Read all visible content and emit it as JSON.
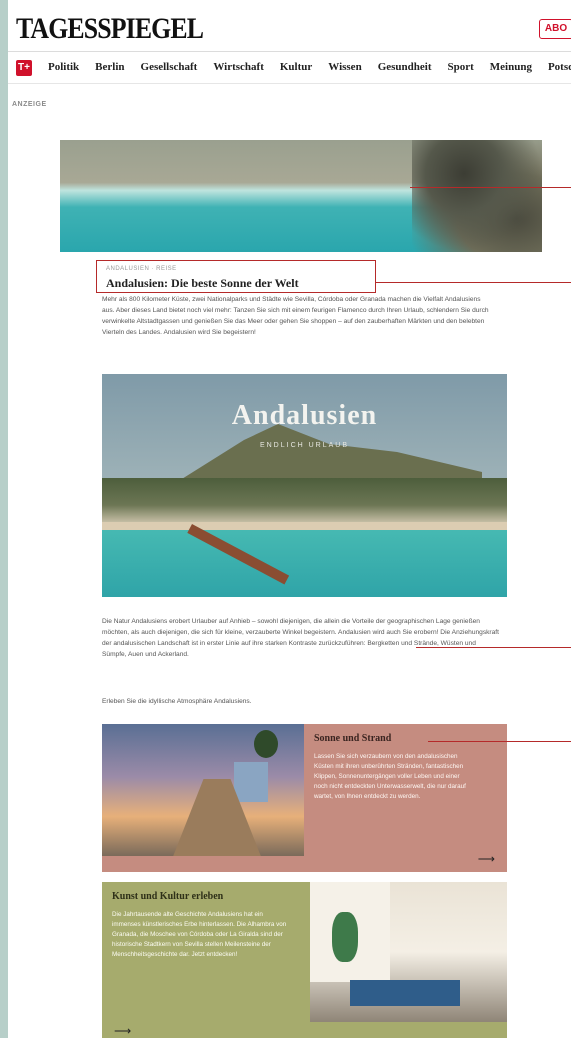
{
  "header": {
    "logo": "TAGESSPIEGEL",
    "abo_label": "ABO",
    "tplus_label": "T+"
  },
  "nav": {
    "items": [
      "Politik",
      "Berlin",
      "Gesellschaft",
      "Wirtschaft",
      "Kultur",
      "Wissen",
      "Gesundheit",
      "Sport",
      "Meinung",
      "Potsdam"
    ]
  },
  "ad": {
    "label": "ANZEIGE",
    "kicker": "ANDALUSIEN · REISE",
    "headline": "Andalusien: Die beste Sonne der Welt",
    "intro": "Mehr als 800 Kilometer Küste, zwei Nationalparks und Städte wie Sevilla, Córdoba oder Granada machen die Vielfalt Andalusiens aus. Aber dieses Land bietet noch viel mehr: Tanzen Sie sich mit einem feurigen Flamenco durch Ihren Urlaub, schlendern Sie durch verwinkelte Altstadtgassen und genießen Sie das Meer oder gehen Sie shoppen – auf den zauberhaften Märkten und den belebten Vierteln des Landes. Andalusien wird Sie begeistern!",
    "photo_title": "Andalusien",
    "photo_subtitle": "ENDLICH URLAUB",
    "body1": "Die Natur Andalusiens erobert Urlauber auf Anhieb – sowohl diejenigen, die allein die Vorteile der geographischen Lage genießen möchten, als auch diejenigen, die sich für kleine, verzauberte Winkel begeistern. Andalusien wird auch Sie erobern! Die Anziehungskraft der andalusischen Landschaft ist in erster Linie auf ihre starken Kontraste zurückzuführen: Bergketten und Strände, Wüsten und Sümpfe, Auen und Ackerland.",
    "body2": "Erleben Sie die idyllische Atmosphäre Andalusiens.",
    "cards": [
      {
        "title": "Sonne und Strand",
        "text": "Lassen Sie sich verzaubern von den andalusischen Küsten mit ihren unberührten Stränden, fantastischen Klippen, Sonnenuntergängen voller Leben und einer noch nicht entdeckten Unterwasserwelt, die nur darauf wartet, von Ihnen entdeckt zu werden.",
        "arrow": "⟶"
      },
      {
        "title": "Kunst und Kultur erleben",
        "text": "Die Jahrtausende alte Geschichte Andalusiens hat ein immenses künstlerisches Erbe hinterlassen. Die Alhambra von Granada, die Moschee von Córdoba oder La Giralda sind der historische Stadtkern von Sevilla stellen Meilensteine der Menschheitsgeschichte dar. Jetzt entdecken!",
        "arrow": "⟶"
      }
    ]
  },
  "colors": {
    "brand_red": "#d0112b",
    "annotation_red": "#b52a2a",
    "card1_bg": "#c58c80",
    "card2_bg": "#a6ab6d",
    "page_bg": "#b7cfc9"
  }
}
